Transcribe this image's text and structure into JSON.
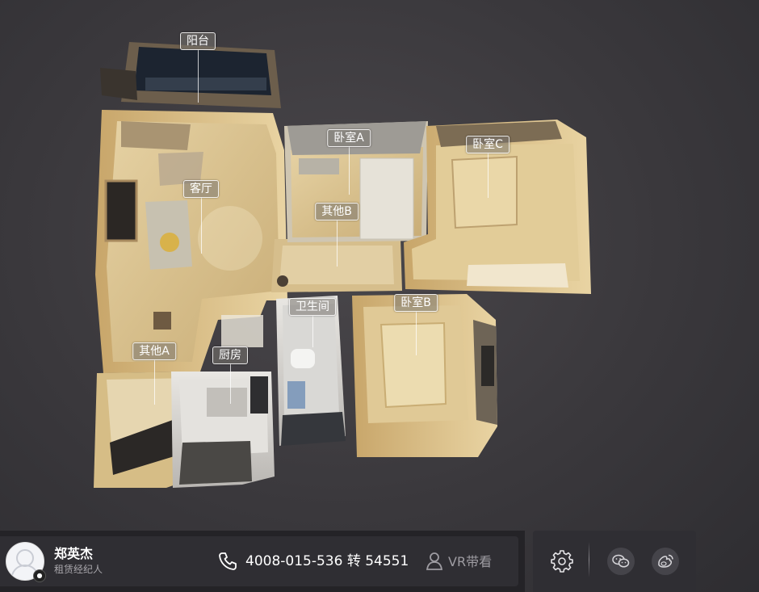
{
  "rooms": [
    {
      "id": "balcony",
      "label": "阳台"
    },
    {
      "id": "bedroom-a",
      "label": "卧室A"
    },
    {
      "id": "bedroom-c",
      "label": "卧室C"
    },
    {
      "id": "living-room",
      "label": "客厅"
    },
    {
      "id": "other-b",
      "label": "其他B"
    },
    {
      "id": "bathroom",
      "label": "卫生间"
    },
    {
      "id": "bedroom-b",
      "label": "卧室B"
    },
    {
      "id": "other-a",
      "label": "其他A"
    },
    {
      "id": "kitchen",
      "label": "厨房"
    }
  ],
  "agent": {
    "name": "郑英杰",
    "role": "租赁经纪人",
    "avatar_icon": "user-avatar-icon"
  },
  "contact": {
    "phone_icon": "phone-icon",
    "phone": "4008-015-536 转 54551"
  },
  "vr_tour": {
    "icon": "user-outline-icon",
    "label": "VR带看"
  },
  "toolbar": {
    "settings_icon": "gear-icon",
    "wechat_icon": "wechat-icon",
    "weibo_icon": "weibo-icon"
  },
  "colors": {
    "background": "#3a383c",
    "floor": "#d8c294",
    "bar": "#2f2e33"
  }
}
